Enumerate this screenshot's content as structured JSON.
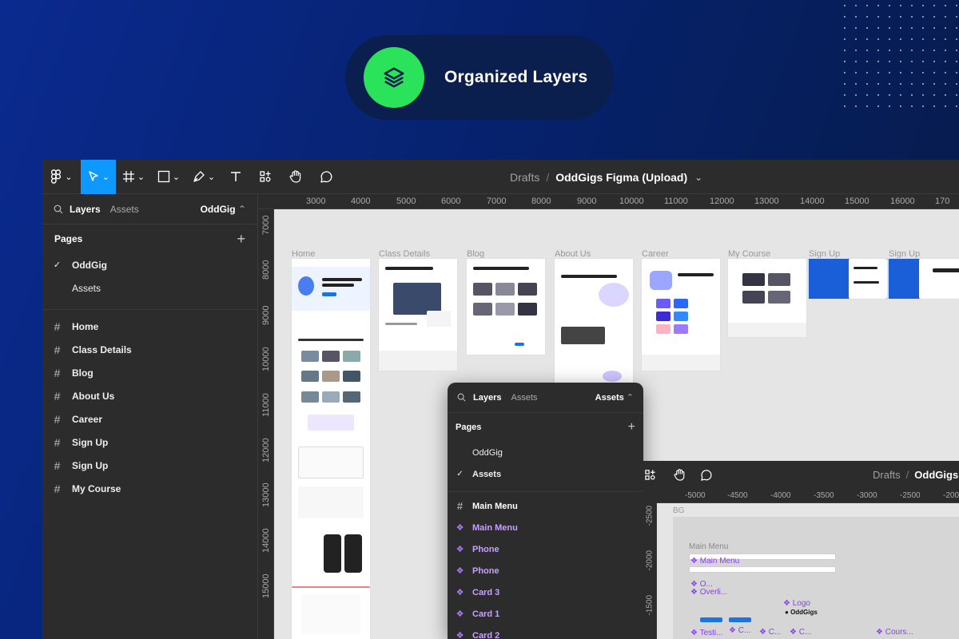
{
  "colors": {
    "accent": "#0d99ff",
    "badge_green": "#2be35a",
    "component_purple": "#a97bff"
  },
  "badge": {
    "icon": "layers-icon",
    "title": "Organized Layers"
  },
  "toolbar": {
    "breadcrumb_parent": "Drafts",
    "breadcrumb_sep": "/",
    "file_name": "OddGigs Figma (Upload)",
    "tools": [
      "figma-menu",
      "move-tool",
      "frame-tool",
      "shape-tool",
      "pen-tool",
      "text-tool",
      "resources-tool",
      "hand-tool",
      "comment-tool"
    ]
  },
  "sidebar": {
    "tab_layers": "Layers",
    "tab_assets": "Assets",
    "page_selector": "OddGig",
    "pages_title": "Pages",
    "pages": [
      {
        "label": "OddGig",
        "checked": true
      },
      {
        "label": "Assets",
        "checked": false
      }
    ],
    "layers": [
      "Home",
      "Class Details",
      "Blog",
      "About Us",
      "Career",
      "Sign Up",
      "Sign Up",
      "My Course"
    ]
  },
  "ruler": {
    "x": [
      "3000",
      "4000",
      "5000",
      "6000",
      "7000",
      "8000",
      "9000",
      "10000",
      "11000",
      "12000",
      "13000",
      "14000",
      "15000",
      "16000",
      "170"
    ],
    "y": [
      "7000",
      "8000",
      "9000",
      "10000",
      "11000",
      "12000",
      "13000",
      "14000",
      "15000"
    ]
  },
  "canvas": {
    "frames": [
      "Home",
      "Class Details",
      "Blog",
      "About Us",
      "Career",
      "My Course",
      "Sign Up",
      "Sign Up"
    ]
  },
  "floating_panel": {
    "tab_layers": "Layers",
    "tab_assets": "Assets",
    "page_selector": "Assets",
    "pages_title": "Pages",
    "pages": [
      {
        "label": "OddGig",
        "checked": false
      },
      {
        "label": "Assets",
        "checked": true
      }
    ],
    "layers": [
      {
        "label": "Main Menu",
        "kind": "frame"
      },
      {
        "label": "Main Menu",
        "kind": "component"
      },
      {
        "label": "Phone",
        "kind": "component"
      },
      {
        "label": "Phone",
        "kind": "component"
      },
      {
        "label": "Card 3",
        "kind": "component"
      },
      {
        "label": "Card 1",
        "kind": "component"
      },
      {
        "label": "Card 2",
        "kind": "component"
      }
    ]
  },
  "second_window": {
    "breadcrumb_parent": "Drafts",
    "breadcrumb_sep": "/",
    "file_name": "OddGigs F",
    "ruler_x": [
      "-5000",
      "-4500",
      "-4000",
      "-3500",
      "-3000",
      "-2500",
      "-200"
    ],
    "ruler_y": [
      "-2500",
      "-2000",
      "-1500"
    ],
    "bg_label": "BG",
    "frame_label": "Main Menu",
    "components": [
      "Main Menu",
      "O...",
      "Overli...",
      "Logo",
      "OddGigs",
      "Testi...",
      "C...",
      "C...",
      "C...",
      "Cours..."
    ]
  }
}
